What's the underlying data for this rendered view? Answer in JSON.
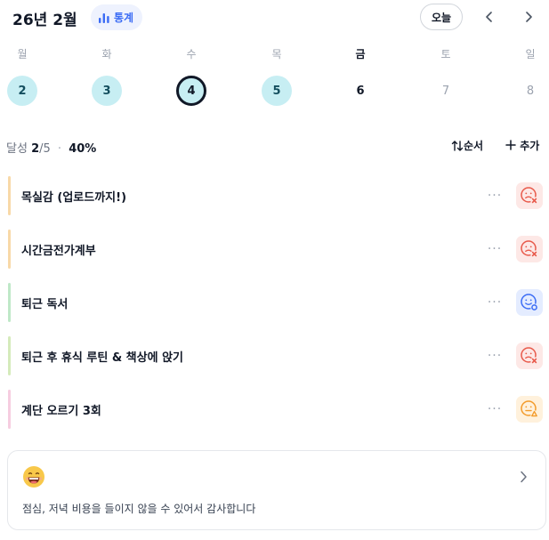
{
  "header": {
    "title": "26년 2월",
    "stats_label": "통계",
    "today_label": "오늘",
    "prev_icon": "chevron-left-icon",
    "next_icon": "chevron-right-icon",
    "accent": "#3b6cf5"
  },
  "week": {
    "days": [
      {
        "name": "월",
        "num": "2",
        "state": "done"
      },
      {
        "name": "화",
        "num": "3",
        "state": "done"
      },
      {
        "name": "수",
        "num": "4",
        "state": "selected"
      },
      {
        "name": "목",
        "num": "5",
        "state": "done"
      },
      {
        "name": "금",
        "num": "6",
        "state": "today"
      },
      {
        "name": "토",
        "num": "7",
        "state": "future"
      },
      {
        "name": "일",
        "num": "8",
        "state": "future"
      }
    ]
  },
  "summary": {
    "label": "달성",
    "done": "2",
    "total": "/5",
    "separator": "·",
    "percent": "40%"
  },
  "actions": {
    "sort_label": "순서",
    "add_label": "추가"
  },
  "tasks": [
    {
      "title": "목실감 (업로드까지!)",
      "bar_color": "#f8d9a8",
      "status": "sad-face-x-icon",
      "status_color": "#e8594a"
    },
    {
      "title": "시간금전가계부",
      "bar_color": "#f8d9a8",
      "status": "sad-face-x-icon",
      "status_color": "#e8594a"
    },
    {
      "title": "퇴근 독서",
      "bar_color": "#bfe8c8",
      "status": "face-progress-icon",
      "status_color": "#3b6cf5"
    },
    {
      "title": "퇴근 후 휴식 루틴 & 책상에 앉기",
      "bar_color": "#d5ebbb",
      "status": "sad-face-x-icon",
      "status_color": "#e8594a"
    },
    {
      "title": "계단 오르기 3회",
      "bar_color": "#f6cde0",
      "status": "face-warning-icon",
      "status_color": "#f39b2a"
    }
  ],
  "more_label": "···",
  "note": {
    "text": "점심, 저녁 비용을 들이지 않을 수 있어서 감사합니다",
    "emoji": "grinning-face-icon"
  }
}
